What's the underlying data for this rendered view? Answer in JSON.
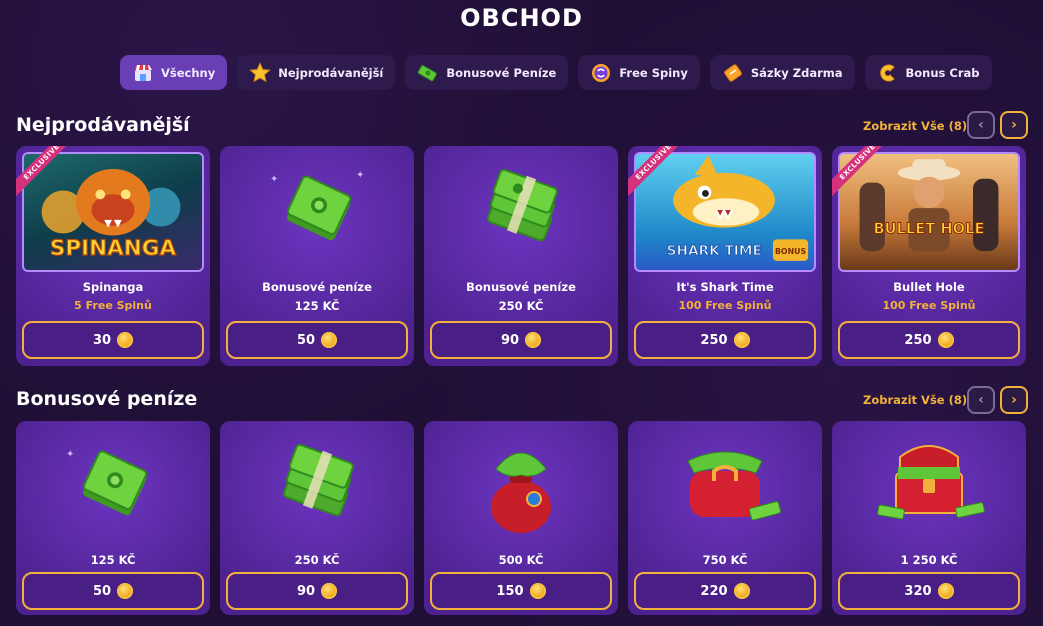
{
  "title": "OBCHOD",
  "tabs": [
    {
      "label": "Všechny",
      "icon": "shop-icon",
      "active": true
    },
    {
      "label": "Nejprodávanější",
      "icon": "star-icon",
      "active": false
    },
    {
      "label": "Bonusové Peníze",
      "icon": "cash-icon",
      "active": false
    },
    {
      "label": "Free Spiny",
      "icon": "spin-icon",
      "active": false
    },
    {
      "label": "Sázky Zdarma",
      "icon": "ticket-icon",
      "active": false
    },
    {
      "label": "Bonus Crab",
      "icon": "crab-claw-icon",
      "active": false
    }
  ],
  "sections": [
    {
      "title": "Nejprodávanější",
      "view_all": "Zobrazit Vše (8)",
      "items": [
        {
          "name": "Spinanga",
          "sub": "5 Free Spinů",
          "price": "30",
          "art": "spinanga-game-art",
          "exclusive": "EXCLUSIVE"
        },
        {
          "name": "Bonusové peníze",
          "sub": "125 KČ",
          "price": "50",
          "art": "cash-stack-small"
        },
        {
          "name": "Bonusové peníze",
          "sub": "250 KČ",
          "price": "90",
          "art": "cash-stack-large"
        },
        {
          "name": "It's Shark Time",
          "sub": "100 Free Spinů",
          "price": "250",
          "art": "shark-time-game-art",
          "exclusive": "EXCLUSIVE"
        },
        {
          "name": "Bullet Hole",
          "sub": "100 Free Spinů",
          "price": "250",
          "art": "bullet-hole-game-art",
          "exclusive": "EXCLUSIVE"
        }
      ]
    },
    {
      "title": "Bonusové peníze",
      "view_all": "Zobrazit Vše (8)",
      "items": [
        {
          "name": "125 KČ",
          "price": "50",
          "art": "cash-stack-small"
        },
        {
          "name": "250 KČ",
          "price": "90",
          "art": "cash-stack-large"
        },
        {
          "name": "500 KČ",
          "price": "150",
          "art": "money-bag"
        },
        {
          "name": "750 KČ",
          "price": "220",
          "art": "money-purse"
        },
        {
          "name": "1 250 KČ",
          "price": "320",
          "art": "treasure-chest"
        }
      ]
    }
  ],
  "game_logos": {
    "spinanga": "SPINANGA",
    "shark_time": "SHARK TIME",
    "shark_bonus": "BONUS",
    "bullet_hole": "BULLET HOLE"
  },
  "colors": {
    "background": "#1f0f35",
    "card": "#5b2aa6",
    "accent": "#f2b13a",
    "tab_active": "#6a3fb5",
    "exclusive_ribbon": "#d6317c"
  }
}
